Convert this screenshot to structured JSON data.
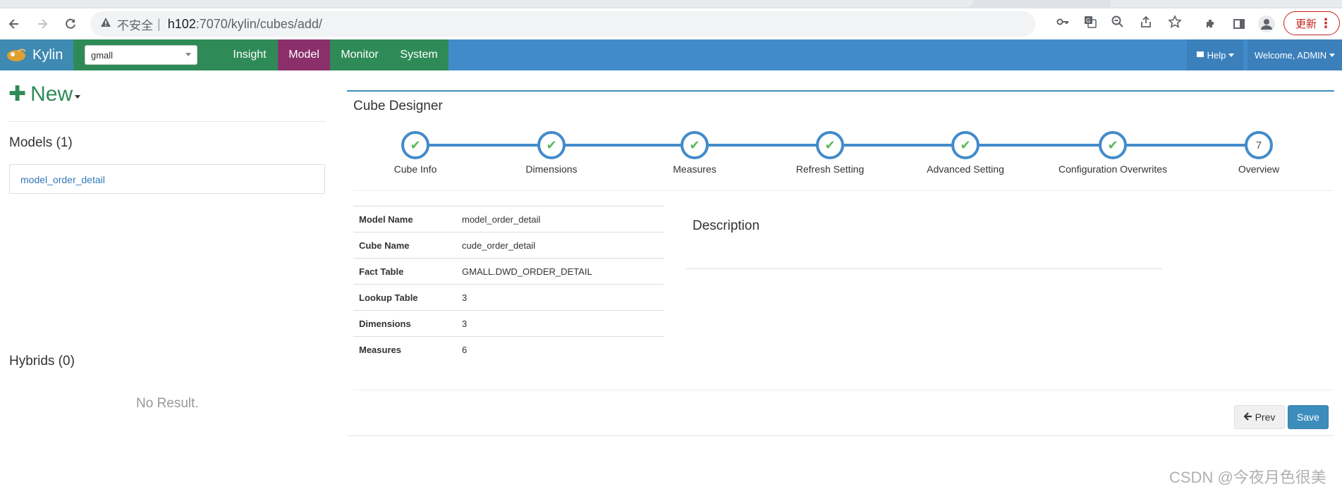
{
  "browser": {
    "security_label": "不安全",
    "url_host": "h102",
    "url_rest": ":7070/kylin/cubes/add/",
    "update_label": "更新"
  },
  "navbar": {
    "brand": "Kylin",
    "project": "gmall",
    "items": [
      "Insight",
      "Model",
      "Monitor",
      "System"
    ],
    "active_item": "Model",
    "help": "Help",
    "welcome": "Welcome, ADMIN"
  },
  "sidebar": {
    "new_label": "New",
    "models_title": "Models (1)",
    "models": [
      "model_order_detail"
    ],
    "hybrids_title": "Hybrids (0)",
    "no_result": "No Result."
  },
  "designer": {
    "title": "Cube Designer",
    "steps": [
      {
        "label": "Cube Info",
        "done": true
      },
      {
        "label": "Dimensions",
        "done": true
      },
      {
        "label": "Measures",
        "done": true
      },
      {
        "label": "Refresh Setting",
        "done": true
      },
      {
        "label": "Advanced Setting",
        "done": true
      },
      {
        "label": "Configuration Overwrites",
        "done": true
      },
      {
        "label": "Overview",
        "done": false,
        "number": "7"
      }
    ],
    "overview": [
      {
        "key": "Model Name",
        "value": "model_order_detail"
      },
      {
        "key": "Cube Name",
        "value": "cude_order_detail"
      },
      {
        "key": "Fact Table",
        "value": "GMALL.DWD_ORDER_DETAIL"
      },
      {
        "key": "Lookup Table",
        "value": "3"
      },
      {
        "key": "Dimensions",
        "value": "3"
      },
      {
        "key": "Measures",
        "value": "6"
      }
    ],
    "description_title": "Description",
    "prev_label": "Prev",
    "save_label": "Save"
  },
  "watermark": "CSDN @今夜月色很美",
  "colors": {
    "navbar": "#428bca",
    "green": "#2e8b57",
    "model_active": "#8b2f6b",
    "step_border": "#428bca",
    "check": "#5cb85c",
    "save": "#3c8dbc"
  }
}
